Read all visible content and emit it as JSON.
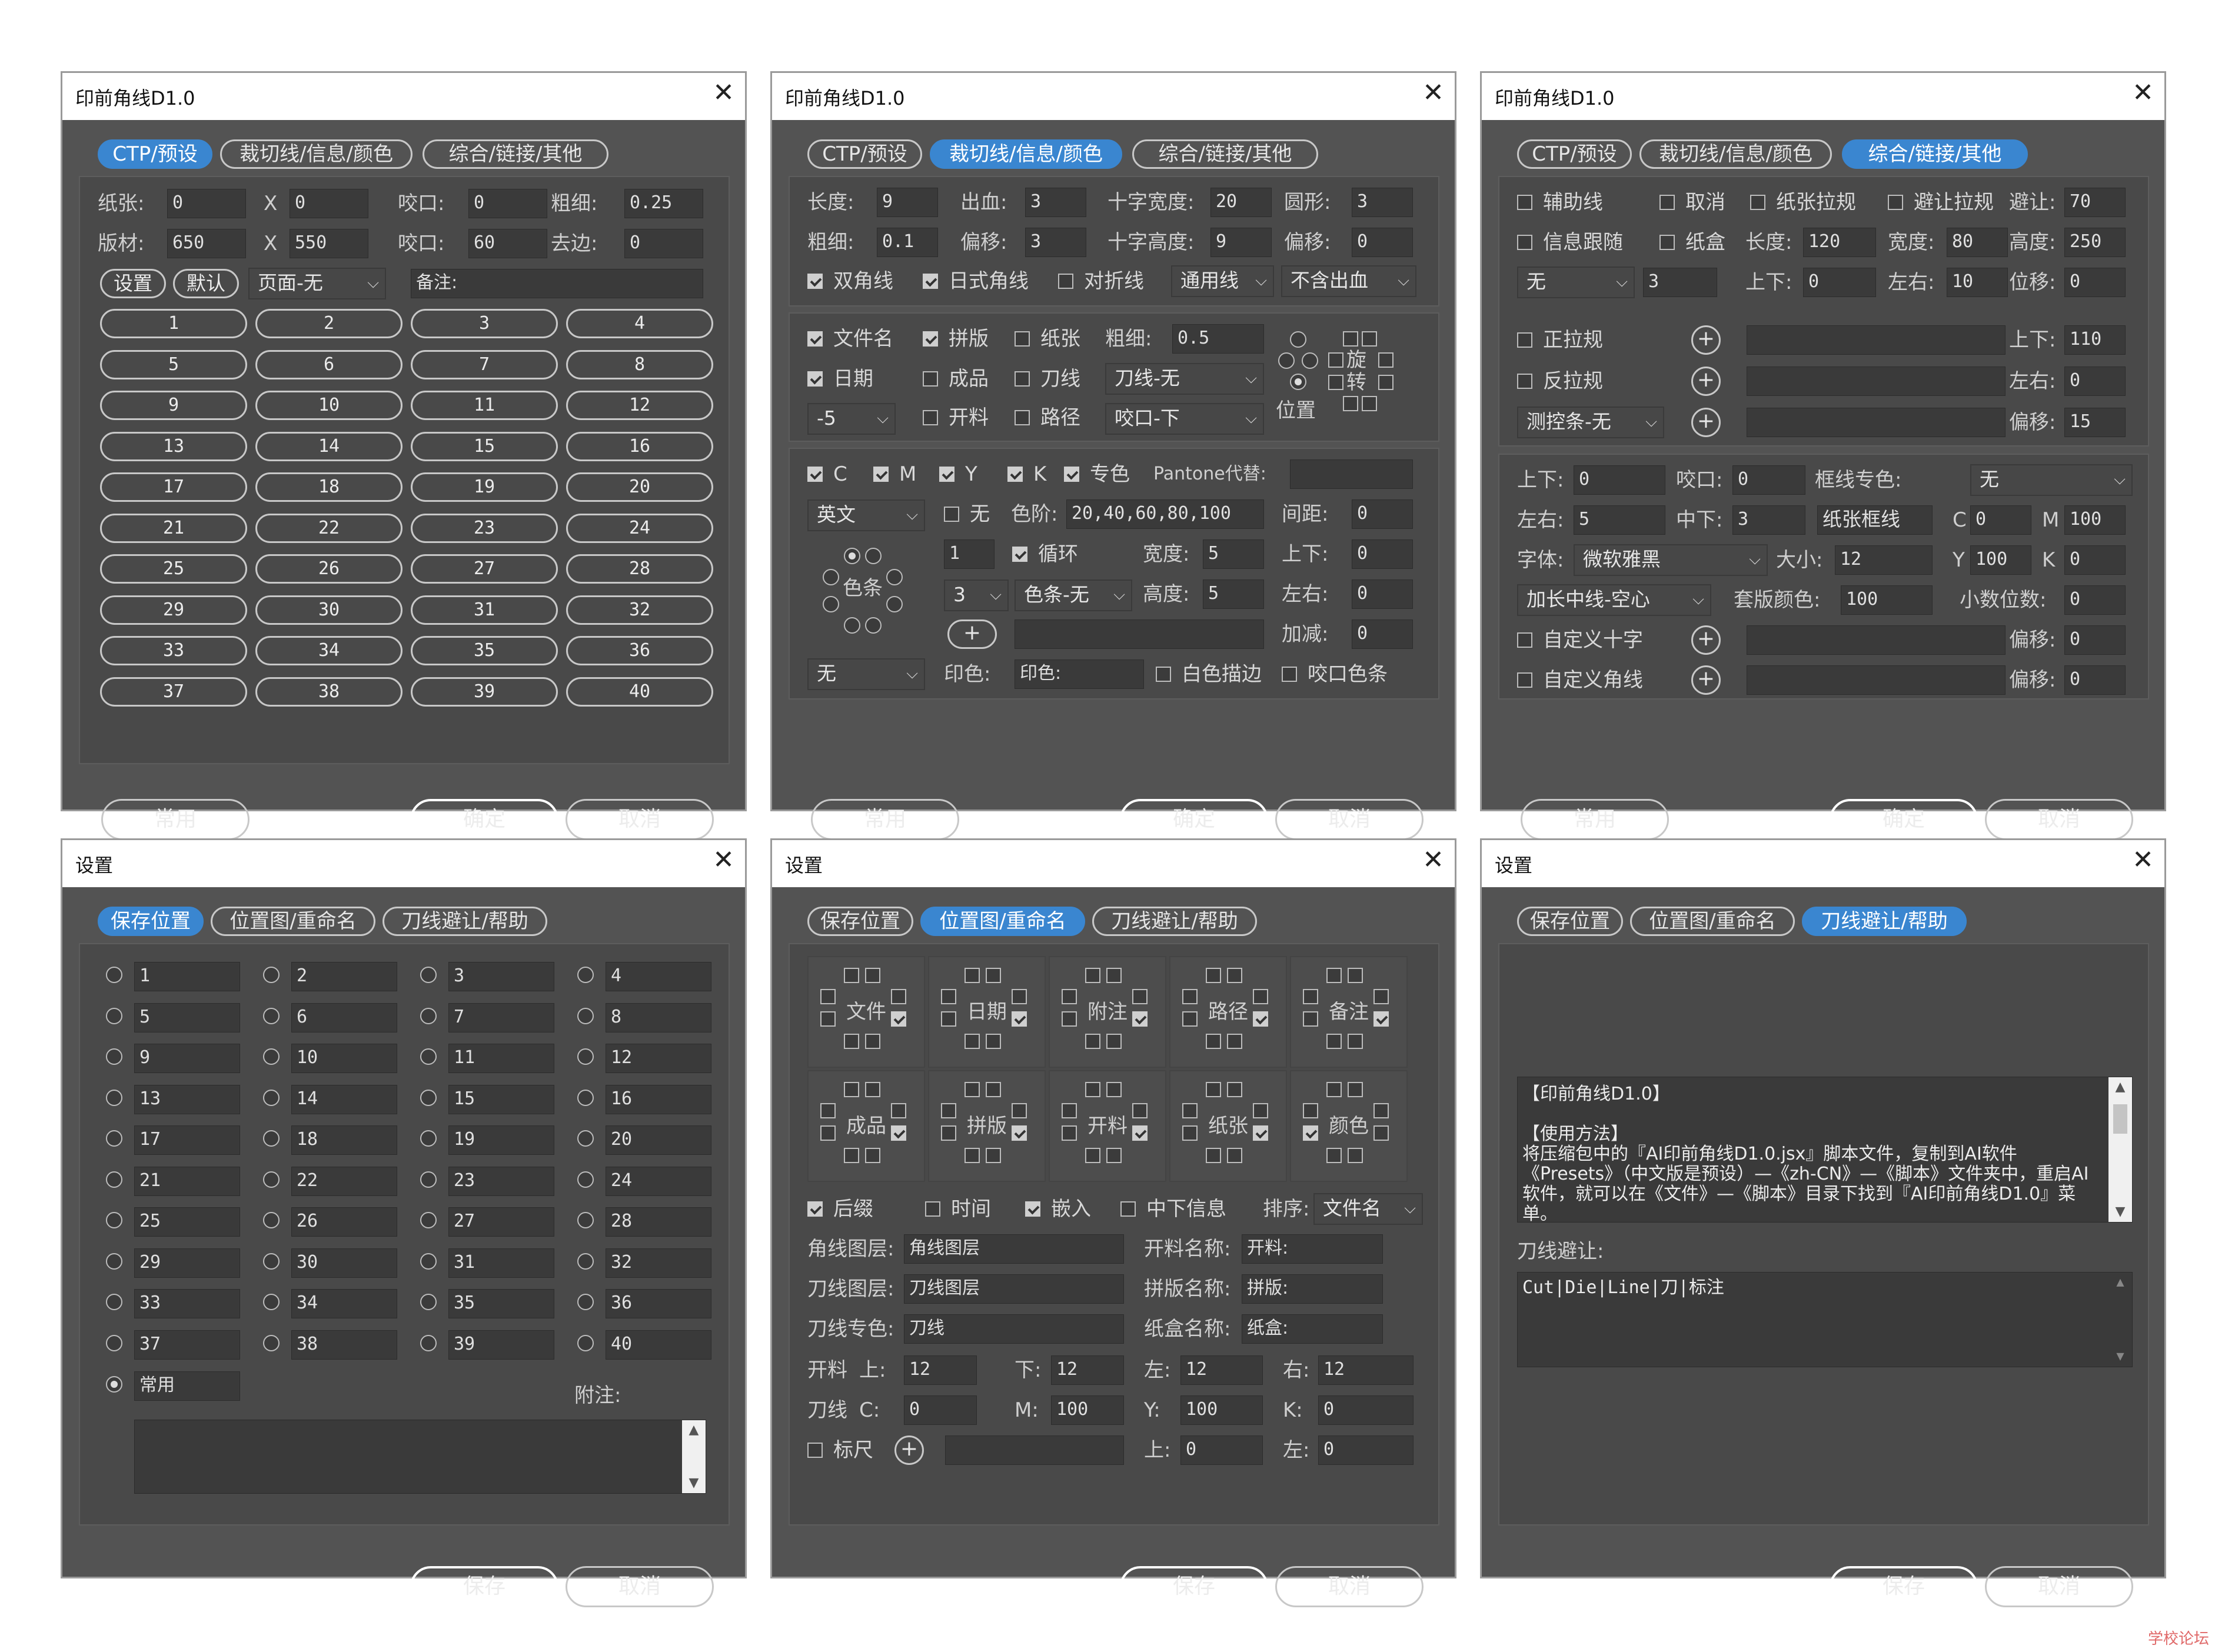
{
  "d1": {
    "title": "印前角线D1.0",
    "close": "✕",
    "tabs": [
      "CTP/预设",
      "裁切线/信息/颜色",
      "综合/链接/其他"
    ],
    "paper_label": "纸张:",
    "paper_w": "0",
    "paper_x": "X",
    "paper_h": "0",
    "bite1_label": "咬口:",
    "bite1": "0",
    "thick_label": "粗细:",
    "thick": "0.25",
    "plate_label": "版材:",
    "plate_w": "650",
    "plate_x": "X",
    "plate_h": "550",
    "bite2_label": "咬口:",
    "bite2": "60",
    "edge_label": "去边:",
    "edge": "0",
    "settings_btn": "设置",
    "default_btn": "默认",
    "page_select": "页面-无",
    "note_label": "备注:",
    "presets": [
      "1",
      "2",
      "3",
      "4",
      "5",
      "6",
      "7",
      "8",
      "9",
      "10",
      "11",
      "12",
      "13",
      "14",
      "15",
      "16",
      "17",
      "18",
      "19",
      "20",
      "21",
      "22",
      "23",
      "24",
      "25",
      "26",
      "27",
      "28",
      "29",
      "30",
      "31",
      "32",
      "33",
      "34",
      "35",
      "36",
      "37",
      "38",
      "39",
      "40"
    ],
    "btn_common": "常用",
    "btn_ok": "确定",
    "btn_cancel": "取消"
  },
  "d2": {
    "title": "印前角线D1.0",
    "close": "✕",
    "tabs": [
      "CTP/预设",
      "裁切线/信息/颜色",
      "综合/链接/其他"
    ],
    "len_label": "长度:",
    "len": "9",
    "bleed_label": "出血:",
    "bleed": "3",
    "cw_label": "十字宽度:",
    "cw": "20",
    "circle_label": "圆形:",
    "circle": "3",
    "thk_label": "粗细:",
    "thk": "0.1",
    "off_label": "偏移:",
    "off": "3",
    "ch_label": "十字高度:",
    "ch": "9",
    "off2_label": "偏移:",
    "off2": "0",
    "cb_double": "双角线",
    "cb_jp": "日式角线",
    "cb_fold": "对折线",
    "sel_line": "通用线",
    "sel_bleed": "不含出血",
    "cb_fname": "文件名",
    "cb_impose": "拼版",
    "cb_paper": "纸张",
    "thk2_label": "粗细:",
    "thk2": "0.5",
    "cb_date": "日期",
    "cb_finish": "成品",
    "cb_knife": "刀线",
    "sel_knife": "刀线-无",
    "sel_m5": "-5",
    "cb_cut": "开料",
    "cb_path": "路径",
    "sel_bite": "咬口-下",
    "rot1": "旋",
    "rot2": "转",
    "pos_label": "位置",
    "cb_c": "C",
    "cb_m": "M",
    "cb_y": "Y",
    "cb_k": "K",
    "cb_spot": "专色",
    "pantone_label": "Pantone代替:",
    "sel_lang": "英文",
    "cb_none": "无",
    "steps_label": "色阶:",
    "steps": "20,40,60,80,100",
    "gap_label": "间距:",
    "gap": "0",
    "cnt": "1",
    "cb_loop": "循环",
    "w_label": "宽度:",
    "w": "5",
    "ud_label": "上下:",
    "ud": "0",
    "colorbar": "色条",
    "sel_3": "3",
    "sel_bar": "色条-无",
    "h_label": "高度:",
    "h": "5",
    "lr_label": "左右:",
    "lr": "0",
    "plus": "+",
    "thick_label": "加减:",
    "thick": "0",
    "sel_none": "无",
    "print_label": "印色:",
    "print_val": "印色:",
    "cb_white": "白色描边",
    "cb_bitebar": "咬口色条",
    "btn_common": "常用",
    "btn_ok": "确定",
    "btn_cancel": "取消"
  },
  "d3": {
    "title": "印前角线D1.0",
    "close": "✕",
    "tabs": [
      "CTP/预设",
      "裁切线/信息/颜色",
      "综合/链接/其他"
    ],
    "cb_aux": "辅助线",
    "cb_cancel": "取消",
    "cb_paperpull": "纸张拉规",
    "cb_avoid": "避让拉规",
    "avoid_label": "避让:",
    "avoid": "70",
    "cb_info": "信息跟随",
    "cb_box": "纸盒",
    "len_label": "长度:",
    "len": "120",
    "wid_label": "宽度:",
    "wid": "80",
    "hei_label": "高度:",
    "hei": "250",
    "sel_none": "无",
    "num3": "3",
    "ud_label": "上下:",
    "ud": "0",
    "lr_label": "左右:",
    "lr": "10",
    "shift_label": "位移:",
    "shift": "0",
    "cb_pos": "正拉规",
    "ud2_label": "上下:",
    "ud2": "110",
    "cb_neg": "反拉规",
    "lr2_label": "左右:",
    "lr2": "0",
    "sel_ctrl": "测控条-无",
    "off_label": "偏移:",
    "off": "15",
    "p_ud_label": "上下:",
    "p_ud": "0",
    "p_bite_label": "咬口:",
    "p_bite": "0",
    "frame_label": "框线专色:",
    "frame_sel": "无",
    "p_lr_label": "左右:",
    "p_lr": "5",
    "p_mid_label": "中下:",
    "p_mid": "3",
    "frame_btn": "纸张框线",
    "c_label": "C",
    "c_val": "0",
    "m_label": "M",
    "m_val": "100",
    "font_label": "字体:",
    "font_sel": "微软雅黑",
    "size_label": "大小:",
    "size": "12",
    "y_label": "Y",
    "y_val": "100",
    "k_label": "K",
    "k_val": "0",
    "mid_sel": "加长中线-空心",
    "reg_label": "套版颜色:",
    "reg": "100",
    "dec_label": "小数位数:",
    "dec": "0",
    "cb_cross": "自定义十字",
    "off2_label": "偏移:",
    "off2": "0",
    "cb_corner": "自定义角线",
    "off3_label": "偏移:",
    "off3": "0",
    "plus": "+",
    "btn_common": "常用",
    "btn_ok": "确定",
    "btn_cancel": "取消"
  },
  "d4": {
    "title": "设置",
    "close": "✕",
    "tabs": [
      "保存位置",
      "位置图/重命名",
      "刀线避让/帮助"
    ],
    "slots": [
      "1",
      "2",
      "3",
      "4",
      "5",
      "6",
      "7",
      "8",
      "9",
      "10",
      "11",
      "12",
      "13",
      "14",
      "15",
      "16",
      "17",
      "18",
      "19",
      "20",
      "21",
      "22",
      "23",
      "24",
      "25",
      "26",
      "27",
      "28",
      "29",
      "30",
      "31",
      "32",
      "33",
      "34",
      "35",
      "36",
      "37",
      "38",
      "39",
      "40"
    ],
    "common": "常用",
    "note_label": "附注:",
    "sb_up": "▲",
    "sb_dn": "▼",
    "btn_save": "保存",
    "btn_cancel": "取消"
  },
  "d5": {
    "title": "设置",
    "close": "✕",
    "tabs": [
      "保存位置",
      "位置图/重命名",
      "刀线避让/帮助"
    ],
    "cells": [
      "文件",
      "日期",
      "附注",
      "路径",
      "备注",
      "成品",
      "拼版",
      "开料",
      "纸张",
      "颜色"
    ],
    "cb_suffix": "后缀",
    "cb_time": "时间",
    "cb_embed": "嵌入",
    "cb_midinfo": "中下信息",
    "sort_label": "排序:",
    "sort_sel": "文件名",
    "l1": "角线图层:",
    "v1": "角线图层",
    "r1": "开料名称:",
    "rv1": "开料:",
    "l2": "刀线图层:",
    "v2": "刀线图层",
    "r2": "拼版名称:",
    "rv2": "拼版:",
    "l3": "刀线专色:",
    "v3": "刀线",
    "r3": "纸盒名称:",
    "rv3": "纸盒:",
    "cut_label": "开料",
    "up_label": "上:",
    "up": "12",
    "down_label": "下:",
    "down": "12",
    "left_label": "左:",
    "left": "12",
    "right_label": "右:",
    "right": "12",
    "knife_label": "刀线",
    "c_label": "C:",
    "c": "0",
    "m_label": "M:",
    "m": "100",
    "y_label": "Y:",
    "y": "100",
    "k_label": "K:",
    "k": "0",
    "cb_ruler": "标尺",
    "plus": "+",
    "up2_label": "上:",
    "up2": "0",
    "left2_label": "左:",
    "left2": "0",
    "btn_save": "保存",
    "btn_cancel": "取消"
  },
  "d6": {
    "title": "设置",
    "close": "✕",
    "tabs": [
      "保存位置",
      "位置图/重命名",
      "刀线避让/帮助"
    ],
    "help_title": "【印前角线D1.0】",
    "help_sub": "【使用方法】",
    "help_body": "将压缩包中的『AI印前角线D1.0.jsx』脚本文件，复制到AI软件《Presets》（中文版是预设）—《zh-CN》—《脚本》文件夹中，重启AI软件，就可以在《文件》—《脚本》目录下找到『AI印前角线D1.0』菜单。",
    "knife_label": "刀线避让:",
    "knife_val": "Cut|Die|Line|刀|标注",
    "sb_up": "▲",
    "sb_dn": "▼",
    "btn_save": "保存",
    "btn_cancel": "取消"
  },
  "watermark": "学校论坛"
}
